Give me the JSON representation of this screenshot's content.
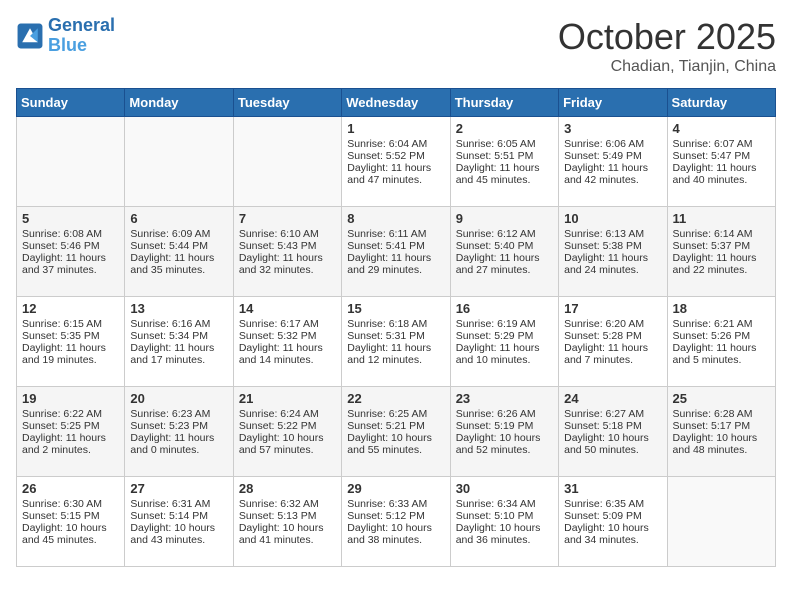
{
  "header": {
    "logo_line1": "General",
    "logo_line2": "Blue",
    "month": "October 2025",
    "location": "Chadian, Tianjin, China"
  },
  "weekdays": [
    "Sunday",
    "Monday",
    "Tuesday",
    "Wednesday",
    "Thursday",
    "Friday",
    "Saturday"
  ],
  "weeks": [
    [
      {
        "day": "",
        "text": ""
      },
      {
        "day": "",
        "text": ""
      },
      {
        "day": "",
        "text": ""
      },
      {
        "day": "1",
        "text": "Sunrise: 6:04 AM\nSunset: 5:52 PM\nDaylight: 11 hours and 47 minutes."
      },
      {
        "day": "2",
        "text": "Sunrise: 6:05 AM\nSunset: 5:51 PM\nDaylight: 11 hours and 45 minutes."
      },
      {
        "day": "3",
        "text": "Sunrise: 6:06 AM\nSunset: 5:49 PM\nDaylight: 11 hours and 42 minutes."
      },
      {
        "day": "4",
        "text": "Sunrise: 6:07 AM\nSunset: 5:47 PM\nDaylight: 11 hours and 40 minutes."
      }
    ],
    [
      {
        "day": "5",
        "text": "Sunrise: 6:08 AM\nSunset: 5:46 PM\nDaylight: 11 hours and 37 minutes."
      },
      {
        "day": "6",
        "text": "Sunrise: 6:09 AM\nSunset: 5:44 PM\nDaylight: 11 hours and 35 minutes."
      },
      {
        "day": "7",
        "text": "Sunrise: 6:10 AM\nSunset: 5:43 PM\nDaylight: 11 hours and 32 minutes."
      },
      {
        "day": "8",
        "text": "Sunrise: 6:11 AM\nSunset: 5:41 PM\nDaylight: 11 hours and 29 minutes."
      },
      {
        "day": "9",
        "text": "Sunrise: 6:12 AM\nSunset: 5:40 PM\nDaylight: 11 hours and 27 minutes."
      },
      {
        "day": "10",
        "text": "Sunrise: 6:13 AM\nSunset: 5:38 PM\nDaylight: 11 hours and 24 minutes."
      },
      {
        "day": "11",
        "text": "Sunrise: 6:14 AM\nSunset: 5:37 PM\nDaylight: 11 hours and 22 minutes."
      }
    ],
    [
      {
        "day": "12",
        "text": "Sunrise: 6:15 AM\nSunset: 5:35 PM\nDaylight: 11 hours and 19 minutes."
      },
      {
        "day": "13",
        "text": "Sunrise: 6:16 AM\nSunset: 5:34 PM\nDaylight: 11 hours and 17 minutes."
      },
      {
        "day": "14",
        "text": "Sunrise: 6:17 AM\nSunset: 5:32 PM\nDaylight: 11 hours and 14 minutes."
      },
      {
        "day": "15",
        "text": "Sunrise: 6:18 AM\nSunset: 5:31 PM\nDaylight: 11 hours and 12 minutes."
      },
      {
        "day": "16",
        "text": "Sunrise: 6:19 AM\nSunset: 5:29 PM\nDaylight: 11 hours and 10 minutes."
      },
      {
        "day": "17",
        "text": "Sunrise: 6:20 AM\nSunset: 5:28 PM\nDaylight: 11 hours and 7 minutes."
      },
      {
        "day": "18",
        "text": "Sunrise: 6:21 AM\nSunset: 5:26 PM\nDaylight: 11 hours and 5 minutes."
      }
    ],
    [
      {
        "day": "19",
        "text": "Sunrise: 6:22 AM\nSunset: 5:25 PM\nDaylight: 11 hours and 2 minutes."
      },
      {
        "day": "20",
        "text": "Sunrise: 6:23 AM\nSunset: 5:23 PM\nDaylight: 11 hours and 0 minutes."
      },
      {
        "day": "21",
        "text": "Sunrise: 6:24 AM\nSunset: 5:22 PM\nDaylight: 10 hours and 57 minutes."
      },
      {
        "day": "22",
        "text": "Sunrise: 6:25 AM\nSunset: 5:21 PM\nDaylight: 10 hours and 55 minutes."
      },
      {
        "day": "23",
        "text": "Sunrise: 6:26 AM\nSunset: 5:19 PM\nDaylight: 10 hours and 52 minutes."
      },
      {
        "day": "24",
        "text": "Sunrise: 6:27 AM\nSunset: 5:18 PM\nDaylight: 10 hours and 50 minutes."
      },
      {
        "day": "25",
        "text": "Sunrise: 6:28 AM\nSunset: 5:17 PM\nDaylight: 10 hours and 48 minutes."
      }
    ],
    [
      {
        "day": "26",
        "text": "Sunrise: 6:30 AM\nSunset: 5:15 PM\nDaylight: 10 hours and 45 minutes."
      },
      {
        "day": "27",
        "text": "Sunrise: 6:31 AM\nSunset: 5:14 PM\nDaylight: 10 hours and 43 minutes."
      },
      {
        "day": "28",
        "text": "Sunrise: 6:32 AM\nSunset: 5:13 PM\nDaylight: 10 hours and 41 minutes."
      },
      {
        "day": "29",
        "text": "Sunrise: 6:33 AM\nSunset: 5:12 PM\nDaylight: 10 hours and 38 minutes."
      },
      {
        "day": "30",
        "text": "Sunrise: 6:34 AM\nSunset: 5:10 PM\nDaylight: 10 hours and 36 minutes."
      },
      {
        "day": "31",
        "text": "Sunrise: 6:35 AM\nSunset: 5:09 PM\nDaylight: 10 hours and 34 minutes."
      },
      {
        "day": "",
        "text": ""
      }
    ]
  ]
}
